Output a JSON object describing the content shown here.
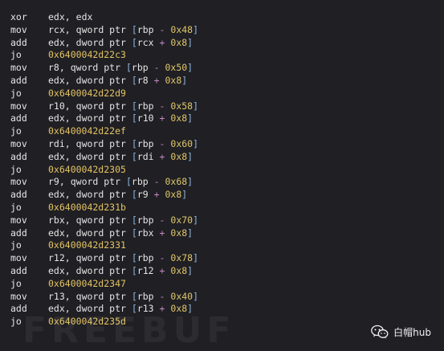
{
  "lines": [
    {
      "mnemonic": "xor",
      "operands": [
        {
          "t": "reg",
          "v": "edx"
        },
        {
          "t": "punct",
          "v": ", "
        },
        {
          "t": "reg",
          "v": "edx"
        }
      ]
    },
    {
      "mnemonic": "mov",
      "operands": [
        {
          "t": "reg",
          "v": "rcx"
        },
        {
          "t": "punct",
          "v": ", "
        },
        {
          "t": "kw",
          "v": "qword ptr "
        },
        {
          "t": "bracket",
          "v": "["
        },
        {
          "t": "reg",
          "v": "rbp"
        },
        {
          "t": "op",
          "v": " - "
        },
        {
          "t": "num",
          "v": "0x48"
        },
        {
          "t": "bracket",
          "v": "]"
        }
      ]
    },
    {
      "mnemonic": "add",
      "operands": [
        {
          "t": "reg",
          "v": "edx"
        },
        {
          "t": "punct",
          "v": ", "
        },
        {
          "t": "kw",
          "v": "dword ptr "
        },
        {
          "t": "bracket",
          "v": "["
        },
        {
          "t": "reg",
          "v": "rcx"
        },
        {
          "t": "op",
          "v": " + "
        },
        {
          "t": "num",
          "v": "0x8"
        },
        {
          "t": "bracket",
          "v": "]"
        }
      ]
    },
    {
      "mnemonic": "jo",
      "operands": [
        {
          "t": "addr",
          "v": "0x6400042d22c3"
        }
      ]
    },
    {
      "mnemonic": "mov",
      "operands": [
        {
          "t": "reg",
          "v": "r8"
        },
        {
          "t": "punct",
          "v": ", "
        },
        {
          "t": "kw",
          "v": "qword ptr "
        },
        {
          "t": "bracket",
          "v": "["
        },
        {
          "t": "reg",
          "v": "rbp"
        },
        {
          "t": "op",
          "v": " - "
        },
        {
          "t": "num",
          "v": "0x50"
        },
        {
          "t": "bracket",
          "v": "]"
        }
      ]
    },
    {
      "mnemonic": "add",
      "operands": [
        {
          "t": "reg",
          "v": "edx"
        },
        {
          "t": "punct",
          "v": ", "
        },
        {
          "t": "kw",
          "v": "dword ptr "
        },
        {
          "t": "bracket",
          "v": "["
        },
        {
          "t": "reg",
          "v": "r8"
        },
        {
          "t": "op",
          "v": " + "
        },
        {
          "t": "num",
          "v": "0x8"
        },
        {
          "t": "bracket",
          "v": "]"
        }
      ]
    },
    {
      "mnemonic": "jo",
      "operands": [
        {
          "t": "addr",
          "v": "0x6400042d22d9"
        }
      ]
    },
    {
      "mnemonic": "mov",
      "operands": [
        {
          "t": "reg",
          "v": "r10"
        },
        {
          "t": "punct",
          "v": ", "
        },
        {
          "t": "kw",
          "v": "qword ptr "
        },
        {
          "t": "bracket",
          "v": "["
        },
        {
          "t": "reg",
          "v": "rbp"
        },
        {
          "t": "op",
          "v": " - "
        },
        {
          "t": "num",
          "v": "0x58"
        },
        {
          "t": "bracket",
          "v": "]"
        }
      ]
    },
    {
      "mnemonic": "add",
      "operands": [
        {
          "t": "reg",
          "v": "edx"
        },
        {
          "t": "punct",
          "v": ", "
        },
        {
          "t": "kw",
          "v": "dword ptr "
        },
        {
          "t": "bracket",
          "v": "["
        },
        {
          "t": "reg",
          "v": "r10"
        },
        {
          "t": "op",
          "v": " + "
        },
        {
          "t": "num",
          "v": "0x8"
        },
        {
          "t": "bracket",
          "v": "]"
        }
      ]
    },
    {
      "mnemonic": "jo",
      "operands": [
        {
          "t": "addr",
          "v": "0x6400042d22ef"
        }
      ]
    },
    {
      "mnemonic": "mov",
      "operands": [
        {
          "t": "reg",
          "v": "rdi"
        },
        {
          "t": "punct",
          "v": ", "
        },
        {
          "t": "kw",
          "v": "qword ptr "
        },
        {
          "t": "bracket",
          "v": "["
        },
        {
          "t": "reg",
          "v": "rbp"
        },
        {
          "t": "op",
          "v": " - "
        },
        {
          "t": "num",
          "v": "0x60"
        },
        {
          "t": "bracket",
          "v": "]"
        }
      ]
    },
    {
      "mnemonic": "add",
      "operands": [
        {
          "t": "reg",
          "v": "edx"
        },
        {
          "t": "punct",
          "v": ", "
        },
        {
          "t": "kw",
          "v": "dword ptr "
        },
        {
          "t": "bracket",
          "v": "["
        },
        {
          "t": "reg",
          "v": "rdi"
        },
        {
          "t": "op",
          "v": " + "
        },
        {
          "t": "num",
          "v": "0x8"
        },
        {
          "t": "bracket",
          "v": "]"
        }
      ]
    },
    {
      "mnemonic": "jo",
      "operands": [
        {
          "t": "addr",
          "v": "0x6400042d2305"
        }
      ]
    },
    {
      "mnemonic": "mov",
      "operands": [
        {
          "t": "reg",
          "v": "r9"
        },
        {
          "t": "punct",
          "v": ", "
        },
        {
          "t": "kw",
          "v": "qword ptr "
        },
        {
          "t": "bracket",
          "v": "["
        },
        {
          "t": "reg",
          "v": "rbp"
        },
        {
          "t": "op",
          "v": " - "
        },
        {
          "t": "num",
          "v": "0x68"
        },
        {
          "t": "bracket",
          "v": "]"
        }
      ]
    },
    {
      "mnemonic": "add",
      "operands": [
        {
          "t": "reg",
          "v": "edx"
        },
        {
          "t": "punct",
          "v": ", "
        },
        {
          "t": "kw",
          "v": "dword ptr "
        },
        {
          "t": "bracket",
          "v": "["
        },
        {
          "t": "reg",
          "v": "r9"
        },
        {
          "t": "op",
          "v": " + "
        },
        {
          "t": "num",
          "v": "0x8"
        },
        {
          "t": "bracket",
          "v": "]"
        }
      ]
    },
    {
      "mnemonic": "jo",
      "operands": [
        {
          "t": "addr",
          "v": "0x6400042d231b"
        }
      ]
    },
    {
      "mnemonic": "mov",
      "operands": [
        {
          "t": "reg",
          "v": "rbx"
        },
        {
          "t": "punct",
          "v": ", "
        },
        {
          "t": "kw",
          "v": "qword ptr "
        },
        {
          "t": "bracket",
          "v": "["
        },
        {
          "t": "reg",
          "v": "rbp"
        },
        {
          "t": "op",
          "v": " - "
        },
        {
          "t": "num",
          "v": "0x70"
        },
        {
          "t": "bracket",
          "v": "]"
        }
      ]
    },
    {
      "mnemonic": "add",
      "operands": [
        {
          "t": "reg",
          "v": "edx"
        },
        {
          "t": "punct",
          "v": ", "
        },
        {
          "t": "kw",
          "v": "dword ptr "
        },
        {
          "t": "bracket",
          "v": "["
        },
        {
          "t": "reg",
          "v": "rbx"
        },
        {
          "t": "op",
          "v": " + "
        },
        {
          "t": "num",
          "v": "0x8"
        },
        {
          "t": "bracket",
          "v": "]"
        }
      ]
    },
    {
      "mnemonic": "jo",
      "operands": [
        {
          "t": "addr",
          "v": "0x6400042d2331"
        }
      ]
    },
    {
      "mnemonic": "mov",
      "operands": [
        {
          "t": "reg",
          "v": "r12"
        },
        {
          "t": "punct",
          "v": ", "
        },
        {
          "t": "kw",
          "v": "qword ptr "
        },
        {
          "t": "bracket",
          "v": "["
        },
        {
          "t": "reg",
          "v": "rbp"
        },
        {
          "t": "op",
          "v": " - "
        },
        {
          "t": "num",
          "v": "0x78"
        },
        {
          "t": "bracket",
          "v": "]"
        }
      ]
    },
    {
      "mnemonic": "add",
      "operands": [
        {
          "t": "reg",
          "v": "edx"
        },
        {
          "t": "punct",
          "v": ", "
        },
        {
          "t": "kw",
          "v": "dword ptr "
        },
        {
          "t": "bracket",
          "v": "["
        },
        {
          "t": "reg",
          "v": "r12"
        },
        {
          "t": "op",
          "v": " + "
        },
        {
          "t": "num",
          "v": "0x8"
        },
        {
          "t": "bracket",
          "v": "]"
        }
      ]
    },
    {
      "mnemonic": "jo",
      "operands": [
        {
          "t": "addr",
          "v": "0x6400042d2347"
        }
      ]
    },
    {
      "mnemonic": "mov",
      "operands": [
        {
          "t": "reg",
          "v": "r13"
        },
        {
          "t": "punct",
          "v": ", "
        },
        {
          "t": "kw",
          "v": "qword ptr "
        },
        {
          "t": "bracket",
          "v": "["
        },
        {
          "t": "reg",
          "v": "rbp"
        },
        {
          "t": "op",
          "v": " - "
        },
        {
          "t": "num",
          "v": "0x40"
        },
        {
          "t": "bracket",
          "v": "]"
        }
      ]
    },
    {
      "mnemonic": "add",
      "operands": [
        {
          "t": "reg",
          "v": "edx"
        },
        {
          "t": "punct",
          "v": ", "
        },
        {
          "t": "kw",
          "v": "dword ptr "
        },
        {
          "t": "bracket",
          "v": "["
        },
        {
          "t": "reg",
          "v": "r13"
        },
        {
          "t": "op",
          "v": " + "
        },
        {
          "t": "num",
          "v": "0x8"
        },
        {
          "t": "bracket",
          "v": "]"
        }
      ]
    },
    {
      "mnemonic": "jo",
      "operands": [
        {
          "t": "addr",
          "v": "0x6400042d235d"
        }
      ]
    }
  ],
  "watermark": {
    "text": "FREEBUF"
  },
  "brand": {
    "label": "白帽hub",
    "icon": "wechat-icon"
  },
  "colors": {
    "background": "#1f1f24",
    "text": "#e6e6e6",
    "number": "#e0c76a",
    "address": "#e6c463",
    "operator": "#c586c0",
    "bracket": "#8fb8e0"
  }
}
